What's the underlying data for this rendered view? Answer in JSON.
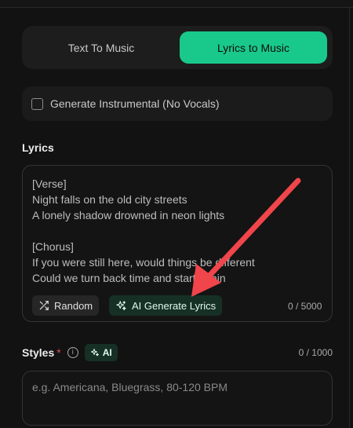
{
  "mode_tabs": [
    {
      "label": "Text To Music",
      "active": false
    },
    {
      "label": "Lyrics to Music",
      "active": true
    }
  ],
  "instrumental": {
    "label": "Generate Instrumental (No Vocals)",
    "checked": false
  },
  "lyrics": {
    "label": "Lyrics",
    "text": "[Verse]\nNight falls on the old city streets\nA lonely shadow drowned in neon lights\n\n[Chorus]\nIf you were still here, would things be different\nCould we turn back time and start again",
    "random_label": "Random",
    "ai_generate_label": "AI Generate Lyrics",
    "counter": "0 / 5000"
  },
  "styles": {
    "label": "Styles",
    "required_mark": "*",
    "ai_badge": "AI",
    "counter": "0 / 1000",
    "placeholder": "e.g. Americana, Bluegrass, 80-120 BPM"
  },
  "colors": {
    "accent": "#19c98b",
    "annotation_arrow": "#f0454a"
  }
}
